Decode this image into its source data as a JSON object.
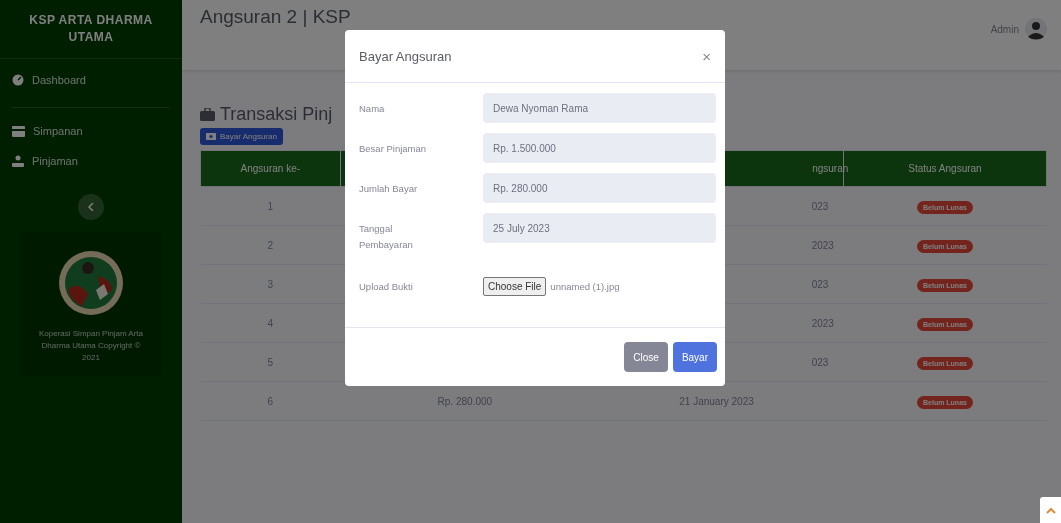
{
  "sidebar": {
    "brand": "KSP ARTA DHARMA UTAMA",
    "items": [
      {
        "label": "Dashboard"
      },
      {
        "label": "Simpanan"
      },
      {
        "label": "Pinjaman"
      }
    ],
    "card_text": "Koperasi Simpan Pinjam Arta Dharma Utama Copyright © 2021"
  },
  "topbar": {
    "title": "Angsuran 2 | KSP",
    "user": "Admin"
  },
  "page": {
    "heading": "Transaksi Pinj",
    "action_button": "Bayar Angsuran"
  },
  "table": {
    "columns": [
      {
        "label": "Angsuran ke-"
      },
      {},
      {
        "label": "ngsuran",
        "clipped": true
      },
      {
        "label": "Status Angsuran"
      }
    ],
    "rows": [
      {
        "cells": [
          {
            "text": "1"
          },
          {},
          {
            "text": "023",
            "clipped": true
          },
          {
            "text": "Belum Lunas",
            "kind": "badge"
          }
        ]
      },
      {
        "cells": [
          {
            "text": "2"
          },
          {},
          {
            "text": "2023",
            "clipped": true
          },
          {
            "text": "Belum Lunas",
            "kind": "badge"
          }
        ]
      },
      {
        "cells": [
          {
            "text": "3"
          },
          {},
          {
            "text": "023",
            "clipped": true
          },
          {
            "text": "Belum Lunas",
            "kind": "badge"
          }
        ]
      },
      {
        "cells": [
          {
            "text": "4"
          },
          {},
          {
            "text": "2023",
            "clipped": true
          },
          {
            "text": "Belum Lunas",
            "kind": "badge"
          }
        ]
      },
      {
        "cells": [
          {
            "text": "5"
          },
          {},
          {
            "text": "023",
            "clipped": true
          },
          {
            "text": "Belum Lunas",
            "kind": "badge"
          }
        ]
      },
      {
        "cells": [
          {
            "text": "6"
          },
          {
            "text": "Rp. 280.000"
          },
          {
            "text": "21 January 2023"
          },
          {
            "text": "Belum Lunas",
            "kind": "badge"
          }
        ]
      }
    ]
  },
  "modal": {
    "title": "Bayar Angsuran",
    "close": "×",
    "fields": [
      {
        "label": "Nama",
        "kind": "text",
        "value": "Dewa Nyoman Rama",
        "readonly": true
      },
      {
        "label": "Besar Pinjaman",
        "kind": "text",
        "value": "Rp. 1.500.000",
        "readonly": true
      },
      {
        "label": "Jumlah Bayar",
        "kind": "text",
        "value": "Rp. 280.000",
        "readonly": true
      },
      {
        "label": "Tanggal Pembayaran",
        "kind": "text",
        "value": "25 July 2023",
        "readonly": true
      },
      {
        "label": "Upload Bukti",
        "kind": "file",
        "button": "Choose File",
        "value": "unnamed (1).jpg"
      }
    ],
    "buttons": [
      {
        "label": "Close",
        "kind": "secondary"
      },
      {
        "label": "Bayar",
        "kind": "primary"
      }
    ]
  }
}
